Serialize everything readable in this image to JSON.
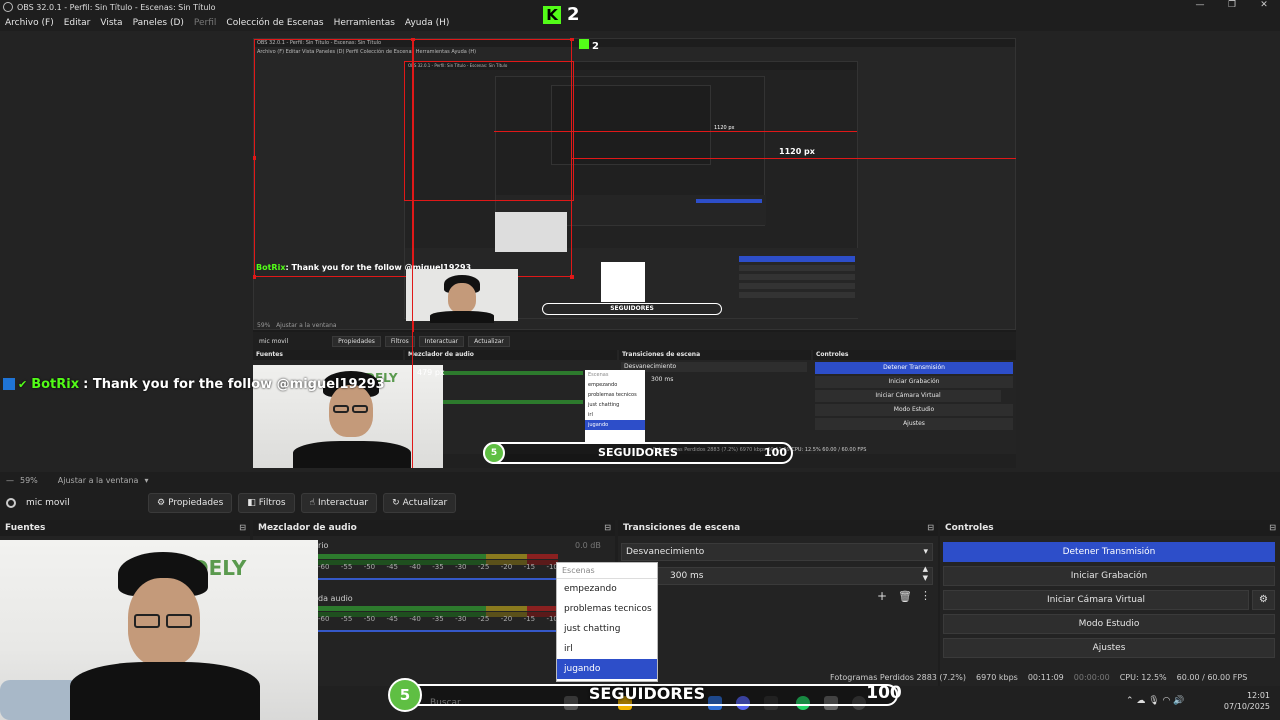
{
  "window": {
    "title": "OBS 32.0.1 - Perfil: Sin Título - Escenas: Sin Título",
    "controls": [
      "—",
      "❐",
      "✕"
    ]
  },
  "menu": {
    "items": [
      {
        "label": "Archivo (F)",
        "enabled": true
      },
      {
        "label": "Editar",
        "enabled": true
      },
      {
        "label": "Vista",
        "enabled": true
      },
      {
        "label": "Paneles (D)",
        "enabled": true
      },
      {
        "label": "Perfil",
        "enabled": false
      },
      {
        "label": "Colección de Escenas",
        "enabled": true
      },
      {
        "label": "Herramientas",
        "enabled": true
      },
      {
        "label": "Ayuda (H)",
        "enabled": true
      }
    ]
  },
  "overlay": {
    "kick_count": "2",
    "chat": {
      "user": "BotRix",
      "message": ": Thank you for the follow @miguel19293"
    },
    "followers": {
      "current": "5",
      "label": "SEGUIDORES",
      "goal": "100"
    },
    "webcam_sign": "DELY"
  },
  "preview": {
    "nested_title": "OBS 32.0.1 - Perfil: Sin Título - Escenas: Sin Título",
    "nested_menu": "Archivo (F)   Editar   Vista   Paneles (D)   Perfil   Colección de Escenas   Herramientas   Ayuda (H)",
    "measure_1": "1120 px",
    "measure_2": "479 px",
    "nested_zoom": "59%",
    "nested_fit": "Ajustar a la ventana",
    "nested_source": "mic movil",
    "nested_toolbar": [
      "Propiedades",
      "Filtros",
      "Interactuar",
      "Actualizar"
    ],
    "nested_docks": [
      "Fuentes",
      "Mezclador de audio",
      "Transiciones de escena",
      "Controles"
    ],
    "nested_transition": "Desvanecimiento",
    "nested_duration": "300 ms",
    "nested_controls": [
      "Detener Transmisión",
      "Iniciar Grabación",
      "Iniciar Cámara Virtual",
      "Modo Estudio",
      "Ajustes"
    ],
    "nested_scenes": [
      "Escenas",
      "empezando",
      "problemas tecnicos",
      "just chatting",
      "irl",
      "jugando"
    ],
    "nested_status": "Fotogramas Perdidos 2883 (7.2%)   6970 kbps   00:11:09   CPU: 12.5%   60.00 / 60.00 FPS"
  },
  "footer": {
    "zoom": "59%",
    "fit": "Ajustar a la ventana"
  },
  "source_toolbar": {
    "source_name": "mic movil",
    "buttons": [
      {
        "icon": "⚙",
        "label": "Propiedades"
      },
      {
        "icon": "◧",
        "label": "Filtros"
      },
      {
        "icon": "☝",
        "label": "Interactuar"
      },
      {
        "icon": "↻",
        "label": "Actualizar"
      }
    ]
  },
  "docks": {
    "sources": {
      "title": "Fuentes"
    },
    "mixer": {
      "title": "Mezclador de audio",
      "track1_label": "rio",
      "track1_db": "0.0 dB",
      "track2_label": "da audio",
      "scale": [
        "-60",
        "-55",
        "-50",
        "-45",
        "-40",
        "-35",
        "-30",
        "-25",
        "-20",
        "-15",
        "-10"
      ]
    },
    "transitions": {
      "title": "Transiciones de escena",
      "type": "Desvanecimiento",
      "duration": "300 ms"
    },
    "controls": {
      "title": "Controles",
      "buttons": [
        {
          "label": "Detener Transmisión",
          "active": true
        },
        {
          "label": "Iniciar Grabación",
          "active": false
        },
        {
          "label": "Iniciar Cámara Virtual",
          "active": false
        },
        {
          "label": "Modo Estudio",
          "active": false
        },
        {
          "label": "Ajustes",
          "active": false
        }
      ]
    }
  },
  "scenes_popup": {
    "header": "Escenas",
    "items": [
      {
        "label": "empezando",
        "selected": false
      },
      {
        "label": "problemas tecnicos",
        "selected": false
      },
      {
        "label": "just chatting",
        "selected": false
      },
      {
        "label": "irl",
        "selected": false
      },
      {
        "label": "jugando",
        "selected": true
      }
    ]
  },
  "status": {
    "dropped": "Fotogramas Perdidos 2883 (7.2%)",
    "bitrate": "6970 kbps",
    "time": "00:11:09",
    "rec_time": "00:00:00",
    "cpu": "CPU: 12.5%",
    "fps": "60.00 / 60.00 FPS"
  },
  "taskbar": {
    "search": "Buscar",
    "time": "12:01",
    "date": "07/10/2025"
  },
  "colors": {
    "accent_blue": "#2d4ec9",
    "kick_green": "#53fc18",
    "follower_green": "#5fbf43",
    "selection_red": "#e01818"
  }
}
